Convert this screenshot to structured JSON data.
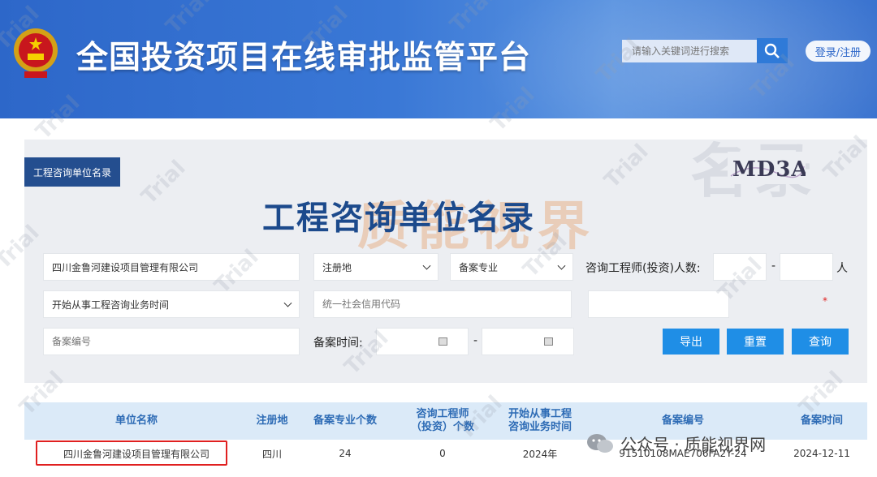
{
  "header": {
    "site_title": "全国投资项目在线审批监管平台",
    "search_placeholder": "请输入关键词进行搜索",
    "login_label": "登录/注册"
  },
  "panel": {
    "tag": "工程咨询单位名录",
    "title": "工程咨询单位名录",
    "deco_text": "名录",
    "brand_watermark": "质能视界",
    "filters": {
      "unit_name_value": "四川金鲁河建设项目管理有限公司",
      "registration_place": "注册地",
      "specialty": "备案专业",
      "consultant_count_label": "咨询工程师(投资)人数:",
      "range_sep": "-",
      "person_unit": "人",
      "start_time_select": "开始从事工程咨询业务时间",
      "credit_code_placeholder": "统一社会信用代码",
      "record_no_placeholder": "备案编号",
      "record_time_label": "备案时间:",
      "captcha_text": "MD3A",
      "captcha_required": "*"
    },
    "buttons": {
      "export": "导出",
      "reset": "重置",
      "query": "查询"
    }
  },
  "table": {
    "headers": {
      "unit_name": "单位名称",
      "reg_place": "注册地",
      "specialty_count": "备案专业个数",
      "consultant_count_1": "咨询工程师",
      "consultant_count_2": "（投资）个数",
      "start_time_1": "开始从事工程",
      "start_time_2": "咨询业务时间",
      "record_no": "备案编号",
      "record_time": "备案时间"
    },
    "rows": [
      {
        "unit_name": "四川金鲁河建设项目管理有限公司",
        "reg_place": "四川",
        "specialty_count": "24",
        "consultant_count": "0",
        "start_time": "2024年",
        "record_no": "91510108MAE706FA2Y-24",
        "record_time": "2024-12-11"
      }
    ]
  },
  "overlay": {
    "trial": "Trial",
    "social": "公众号 · 质能视界网"
  },
  "colors": {
    "header_blue": "#2d67c9",
    "title_navy": "#1c4a8c",
    "button_blue": "#1f8ee6",
    "highlight_red": "#e02020"
  }
}
